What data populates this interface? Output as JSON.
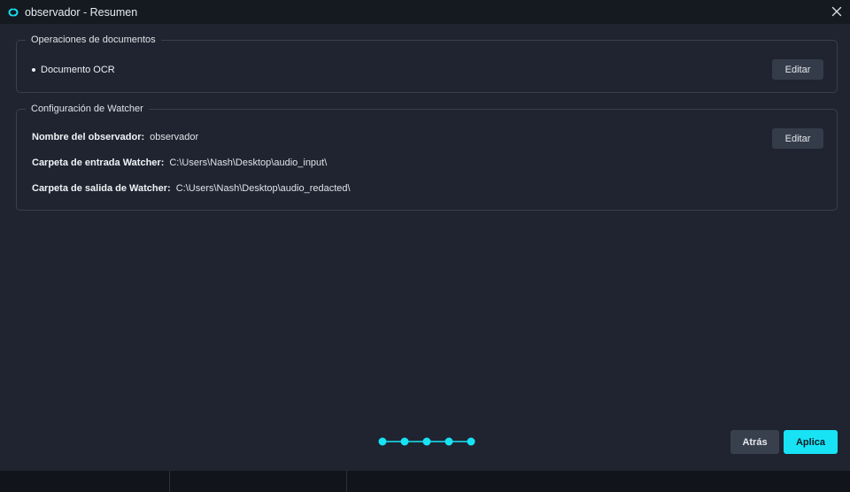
{
  "window": {
    "title": "observador - Resumen",
    "logo_icon": "app-logo-icon",
    "close_icon": "close-icon"
  },
  "document_ops": {
    "legend": "Operaciones de documentos",
    "items": [
      "Documento OCR"
    ],
    "edit_label": "Editar"
  },
  "watcher": {
    "legend": "Configuración de Watcher",
    "edit_label": "Editar",
    "fields": [
      {
        "label": "Nombre del observador:",
        "value": "observador"
      },
      {
        "label": "Carpeta de entrada Watcher:",
        "value": "C:\\Users\\Nash\\Desktop\\audio_input\\"
      },
      {
        "label": "Carpeta de salida de Watcher:",
        "value": "C:\\Users\\Nash\\Desktop\\audio_redacted\\"
      }
    ]
  },
  "stepper": {
    "total_steps": 5,
    "current_step": 5
  },
  "footer": {
    "back_label": "Atrás",
    "apply_label": "Aplica"
  },
  "colors": {
    "accent": "#17e3f5",
    "background": "#1f2430",
    "titlebar": "#151920",
    "button": "#353c49"
  }
}
